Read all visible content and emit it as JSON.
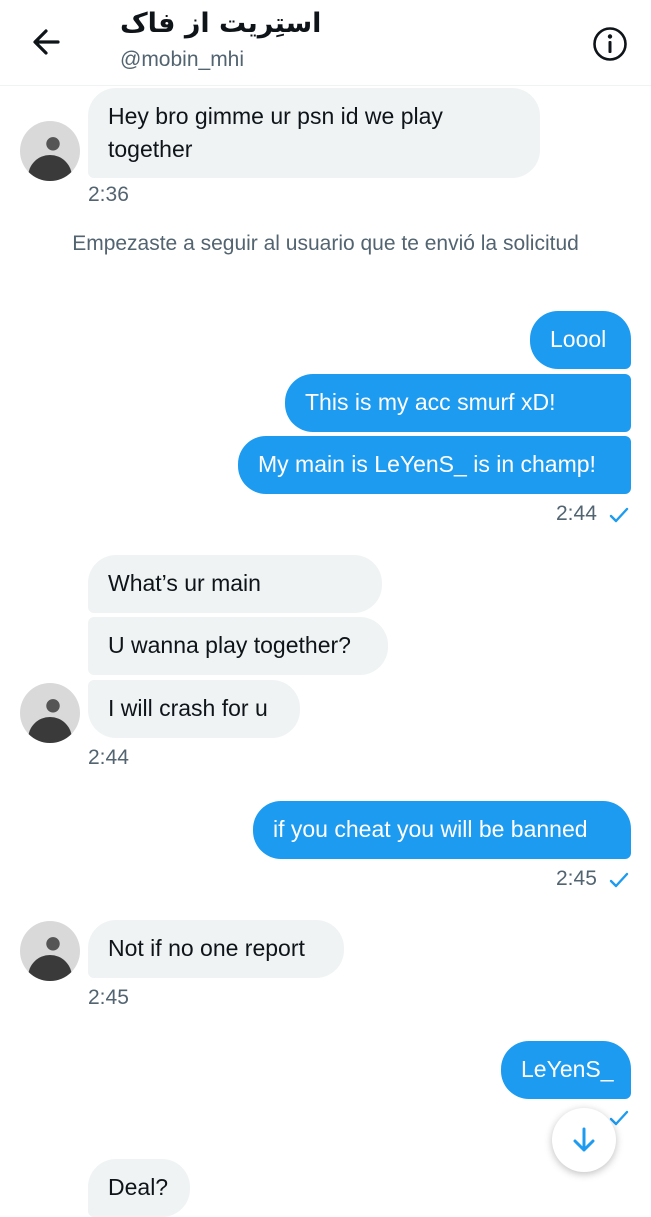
{
  "header": {
    "title": "استِریت از فاک",
    "handle": "@mobin_mhi"
  },
  "messages": {
    "m1_text": "Hey bro gimme ur psn id we play together",
    "m1_time": "2:36",
    "system_notice": "Empezaste a seguir al usuario que te envió la solicitud",
    "m2_text": "Loool",
    "m3_text": "This is my acc smurf xD!",
    "m4_text": "My main is LeYenS_ is in champ!",
    "m4_time": "2:44",
    "m5_text": "What’s ur main",
    "m6_text": "U wanna play together?",
    "m7_text": "I will crash for u",
    "m7_time": "2:44",
    "m8_text": "if you cheat you will be banned",
    "m8_time": "2:45",
    "m9_text": "Not if no one report",
    "m9_time": "2:45",
    "m10_text": "LeYenS_",
    "m11_text": "Deal?"
  },
  "icons": {
    "back": "back-arrow-icon",
    "info": "info-icon",
    "read": "checkmark-icon",
    "scroll": "arrow-down-icon"
  },
  "colors": {
    "accent": "#1d9bf0",
    "incoming_bubble": "#eff3f4",
    "secondary_text": "#536471"
  }
}
